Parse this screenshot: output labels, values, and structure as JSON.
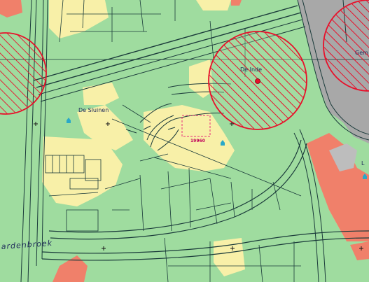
{
  "map": {
    "labels": {
      "de_sluinen": "De Sluinen",
      "de_inde": "De Inde",
      "plot_code": "19960",
      "street_partial": "ardenbroek",
      "gem_partial": "Gem",
      "edge_partial": "L"
    },
    "colors": {
      "agricultural": "#9fdc9f",
      "residential_yellow": "#f8f0a8",
      "commercial_red": "#f0806a",
      "road_gray": "#a8a8a8",
      "line_dark": "#1a3a3a",
      "hatch_red": "#e8102a",
      "plot_pink": "#e82a7a",
      "marker_cyan": "#2aa8c8"
    }
  }
}
